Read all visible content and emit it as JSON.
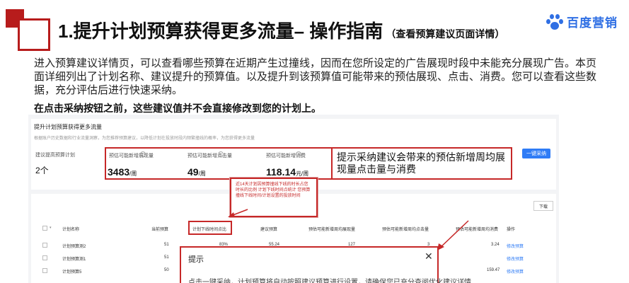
{
  "header": {
    "title": "1.提升计划预算获得更多流量– 操作指南",
    "subtitle": "（查看预算建议页面详情）",
    "logo_text": "百度营销"
  },
  "description": "进入预算建议详情页，可以查看哪些预算在近期产生过撞线，因而在您所设定的广告展现时段中未能充分展现广告。本页面详细列出了计划名称、建议提升的预算值。以及提升到该预算值可能带来的预估展现、点击、消费。您可以查看这些数据，充分评估后进行快速采纳。",
  "bold_note": "在点击采纳按钮之前，这些建议值并不会直接修改到您的计划上。",
  "screenshot": {
    "section_title": "提升计划预算获得更多流量",
    "section_desc": "根据账户历史数据和行业流量洞察，为您推荐预算建议，以降低计划在投放时段内频繁撞线的概率，为您获得更多流量",
    "plan_count_label": "建议提高预算计划",
    "plan_count_value": "2个",
    "metrics": [
      {
        "label": "预估可能新增展现量",
        "value": "3483",
        "unit": "/周"
      },
      {
        "label": "预估可能新增点击量",
        "value": "49",
        "unit": "/周"
      },
      {
        "label": "预估可能新增消费",
        "value": "118.14",
        "unit": "元/周"
      }
    ],
    "callout": "提示采纳建议会带来的预估新增周均展现量点击量与消费",
    "adopt_all_button": "一键采纳",
    "tooltip": "近14天计划因预算撞线下线的时长占您时长的比例 计划下线时间点统计 您预算撞线下线时间/计划设置的投放时间",
    "download_button": "下载",
    "table": {
      "headers": [
        "计划名称",
        "当前预算",
        "计划下线时间点比",
        "建议预算",
        "预估可能新增周均展现量",
        "预估可能新增周均点击量",
        "预估可能新增周均消费",
        "操作"
      ],
      "rows": [
        [
          "计划预算测2",
          "51",
          "83%",
          "55.24",
          "127",
          "3",
          "3.24",
          "修改预算"
        ],
        [
          "计划预算测1",
          "51",
          "",
          "",
          "",
          "",
          "",
          "修改预算"
        ],
        [
          "计划预算5",
          "50",
          "",
          "",
          "",
          "",
          "159.47",
          "修改预算"
        ]
      ]
    },
    "modal": {
      "title": "提示",
      "body": "点击一键采纳，计划预算将自动按照建议预算进行设置，请确保您已充分查阅优化建议详情"
    }
  },
  "colors": {
    "accent_red": "#b71c1c",
    "brand_blue": "#2f6fe4",
    "button_blue": "#2f7cf6"
  }
}
